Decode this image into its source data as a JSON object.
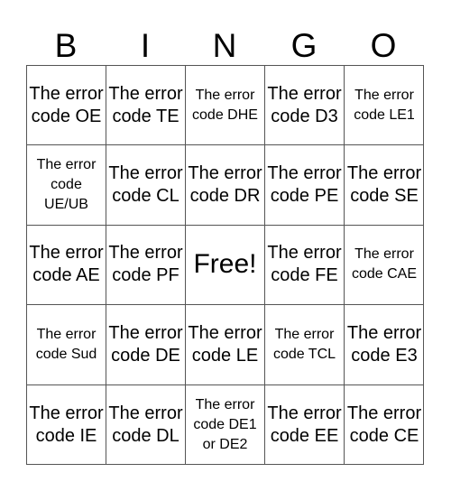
{
  "header": {
    "letters": [
      "B",
      "I",
      "N",
      "G",
      "O"
    ]
  },
  "card": {
    "rows": [
      [
        {
          "text": "The error code OE",
          "size": "lg"
        },
        {
          "text": "The error code TE",
          "size": "lg"
        },
        {
          "text": "The error code DHE",
          "size": "sm"
        },
        {
          "text": "The error code D3",
          "size": "lg"
        },
        {
          "text": "The error code LE1",
          "size": "sm"
        }
      ],
      [
        {
          "text": "The error code UE/UB",
          "size": "sm"
        },
        {
          "text": "The error code CL",
          "size": "lg"
        },
        {
          "text": "The error code DR",
          "size": "lg"
        },
        {
          "text": "The error code PE",
          "size": "lg"
        },
        {
          "text": "The error code SE",
          "size": "lg"
        }
      ],
      [
        {
          "text": "The error code AE",
          "size": "lg"
        },
        {
          "text": "The error code PF",
          "size": "lg"
        },
        {
          "text": "Free!",
          "size": "free"
        },
        {
          "text": "The error code FE",
          "size": "lg"
        },
        {
          "text": "The error code CAE",
          "size": "sm"
        }
      ],
      [
        {
          "text": "The error code Sud",
          "size": "sm"
        },
        {
          "text": "The error code DE",
          "size": "lg"
        },
        {
          "text": "The error code LE",
          "size": "lg"
        },
        {
          "text": "The error code TCL",
          "size": "sm"
        },
        {
          "text": "The error code E3",
          "size": "lg"
        }
      ],
      [
        {
          "text": "The error code IE",
          "size": "lg"
        },
        {
          "text": "The error code DL",
          "size": "lg"
        },
        {
          "text": "The error code DE1 or DE2",
          "size": "sm"
        },
        {
          "text": "The error code EE",
          "size": "lg"
        },
        {
          "text": "The error code CE",
          "size": "lg"
        }
      ]
    ]
  },
  "colors": {
    "grid_line": "#555555",
    "text": "#000000",
    "background": "#ffffff"
  }
}
